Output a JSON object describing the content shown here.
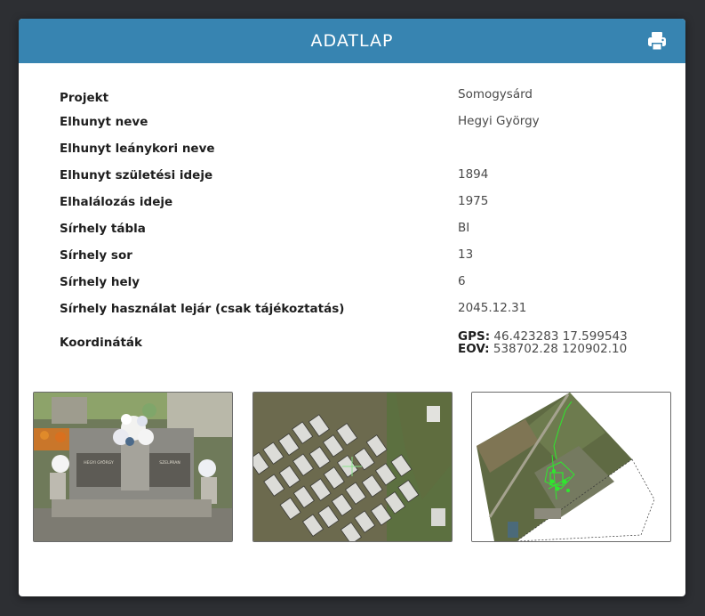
{
  "modal": {
    "title": "ADATLAP",
    "print_icon": "print-icon"
  },
  "fields": [
    {
      "label": "Projekt",
      "value": "Somogysárd"
    },
    {
      "label": "Elhunyt neve",
      "value": "Hegyi György"
    },
    {
      "label": "Elhunyt leánykori neve",
      "value": ""
    },
    {
      "label": "Elhunyt születési ideje",
      "value": "1894"
    },
    {
      "label": "Elhalálozás ideje",
      "value": "1975"
    },
    {
      "label": "Sírhely tábla",
      "value": "BI"
    },
    {
      "label": "Sírhely sor",
      "value": "13"
    },
    {
      "label": "Sírhely hely",
      "value": "6"
    },
    {
      "label": "Sírhely használat lejár (csak tájékoztatás)",
      "value": "2045.12.31"
    }
  ],
  "coordinates": {
    "label": "Koordináták",
    "gps_label": "GPS:",
    "gps_value": "46.423283 17.599543",
    "eov_label": "EOV:",
    "eov_value": "538702.28 120902.10"
  },
  "photos": {
    "grave_inscription_left": "HEGYI GYÖRGY",
    "grave_inscription_right": "SZELPRAN"
  },
  "colors": {
    "header": "#3784b1",
    "backdrop": "#2d2f33"
  }
}
